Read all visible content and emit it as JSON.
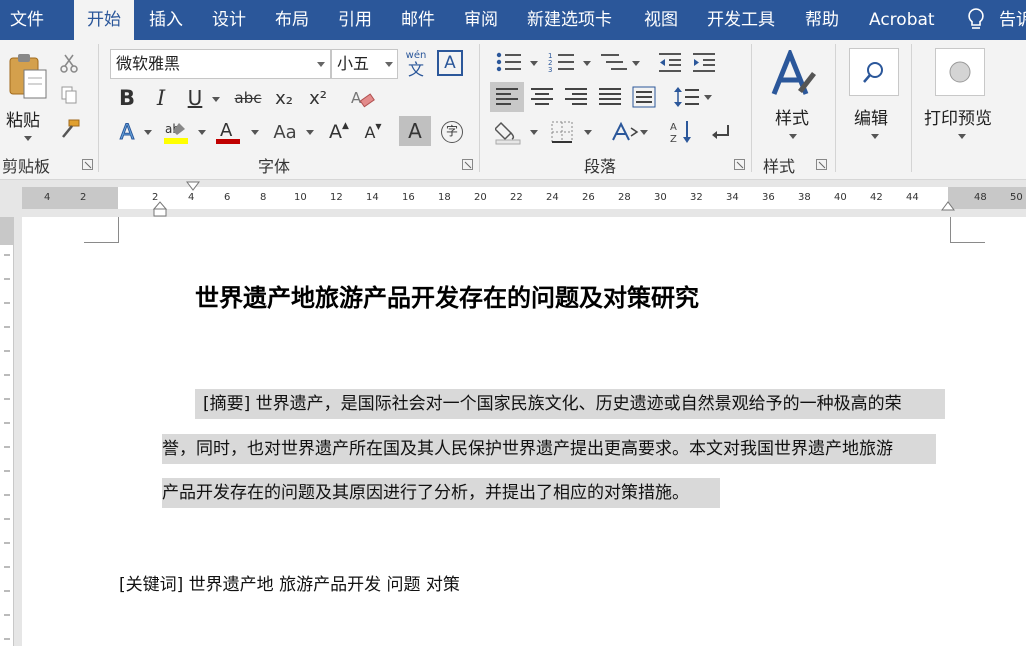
{
  "menu": {
    "tabs": [
      {
        "label": "文件"
      },
      {
        "label": "开始"
      },
      {
        "label": "插入"
      },
      {
        "label": "设计"
      },
      {
        "label": "布局"
      },
      {
        "label": "引用"
      },
      {
        "label": "邮件"
      },
      {
        "label": "审阅"
      },
      {
        "label": "新建选项卡"
      },
      {
        "label": "视图"
      },
      {
        "label": "开发工具"
      },
      {
        "label": "帮助"
      },
      {
        "label": "Acrobat"
      }
    ],
    "tell_me": "告诉",
    "active_tab": "开始"
  },
  "ribbon": {
    "clipboard": {
      "paste_label": "粘贴",
      "group_label": "剪贴板"
    },
    "font": {
      "font_name": "微软雅黑",
      "font_size": "小五",
      "phonetic_top": "wén",
      "phonetic_bottom": "文",
      "bold": "B",
      "italic": "I",
      "underline": "U",
      "strike": "abc",
      "subscript": "x₂",
      "superscript": "x²",
      "grow": "A",
      "shrink": "A",
      "case": "Aa",
      "char_shade": "A",
      "enclose": "字",
      "group_label": "字体"
    },
    "paragraph": {
      "group_label": "段落"
    },
    "styles": {
      "label": "样式",
      "group_label": "样式"
    },
    "editing": {
      "label": "编辑"
    },
    "print_preview": {
      "label": "打印预览"
    },
    "colors": {
      "highlight": "#ffff00",
      "font_color": "#c00000",
      "accent": "#2b579a"
    }
  },
  "ruler": {
    "ticks": [
      "4",
      "2",
      "2",
      "4",
      "6",
      "8",
      "10",
      "12",
      "14",
      "16",
      "18",
      "20",
      "22",
      "24",
      "26",
      "28",
      "30",
      "32",
      "34",
      "36",
      "38",
      "40",
      "42",
      "44",
      "48",
      "50"
    ]
  },
  "document": {
    "title": "世界遗产地旅游产品开发存在的问题及对策研究",
    "abstract_lines": [
      "[摘要] 世界遗产，是国际社会对一个国家民族文化、历史遗迹或自然景观给予的一种极高的荣",
      "誉，同时，也对世界遗产所在国及其人民保护世界遗产提出更高要求。本文对我国世界遗产地旅游",
      "产品开发存在的问题及其原因进行了分析，并提出了相应的对策措施。"
    ],
    "keywords": "[关键词]  世界遗产地    旅游产品开发    问题    对策"
  }
}
